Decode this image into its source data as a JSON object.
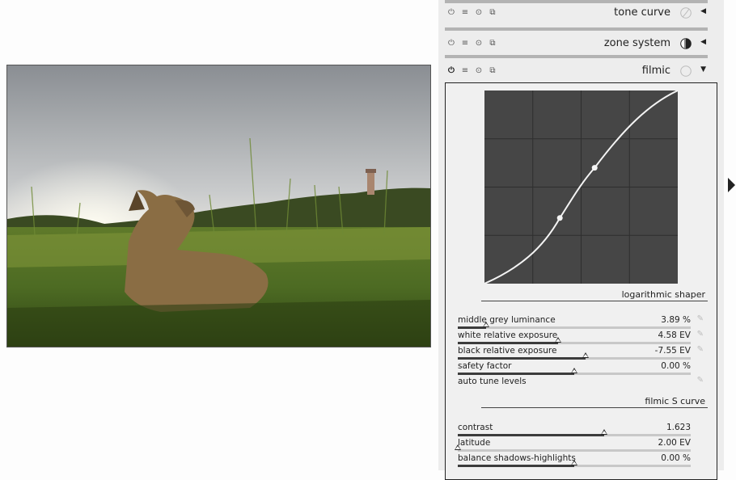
{
  "modules": [
    {
      "label": "tone curve",
      "icon": "tone-curve-icon",
      "state": "collapsed"
    },
    {
      "label": "zone system",
      "icon": "zone-system-icon",
      "state": "collapsed"
    },
    {
      "label": "filmic",
      "icon": "filmic-icon",
      "state": "expanded"
    }
  ],
  "header_icons": [
    "power-icon",
    "presets-icon",
    "reset-icon",
    "duplicate-icon"
  ],
  "filmic": {
    "curve_points": [
      [
        0.0,
        0.0
      ],
      [
        0.39,
        0.34
      ],
      [
        0.57,
        0.6
      ],
      [
        1.0,
        1.0
      ]
    ],
    "section_log": "logarithmic shaper",
    "section_s": "filmic S curve",
    "sliders": [
      {
        "label": "middle grey luminance",
        "value": "3.89 %",
        "position": 0.12,
        "picker": true
      },
      {
        "label": "white relative exposure",
        "value": "4.58 EV",
        "position": 0.43,
        "picker": true
      },
      {
        "label": "black relative exposure",
        "value": "-7.55 EV",
        "position": 0.55,
        "picker": true
      },
      {
        "label": "safety factor",
        "value": "0.00 %",
        "position": 0.5,
        "picker": false
      }
    ],
    "auto_tune": "auto tune levels",
    "s_sliders": [
      {
        "label": "contrast",
        "value": "1.623",
        "position": 0.63
      },
      {
        "label": "latitude",
        "value": "2.00 EV",
        "position": 0.0
      },
      {
        "label": "balance shadows-highlights",
        "value": "0.00 %",
        "position": 0.5
      }
    ]
  },
  "colors": {
    "panel_bg": "#ededed",
    "graph_bg": "#464646",
    "accent": "#222222"
  }
}
